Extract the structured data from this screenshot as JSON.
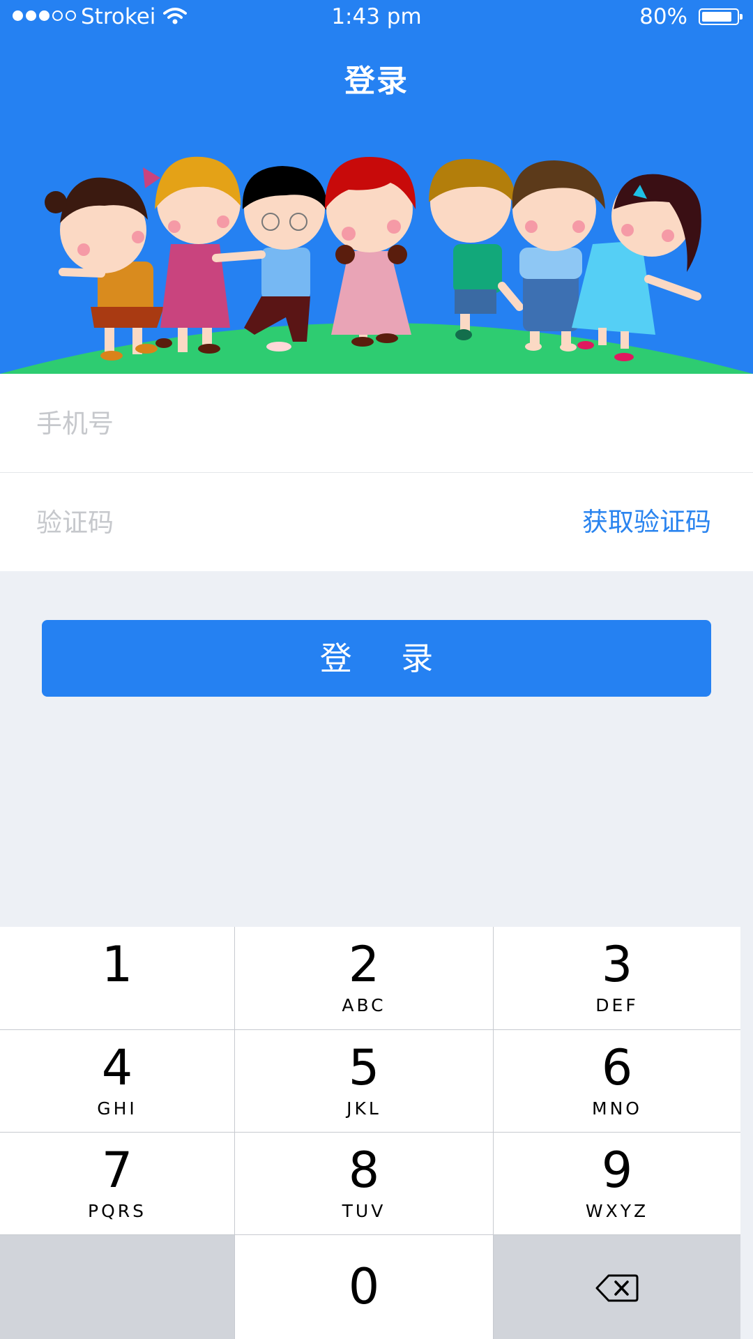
{
  "status_bar": {
    "carrier": "Strokei",
    "time": "1:43 pm",
    "battery": "80%",
    "battery_level": 0.8,
    "signal_bars": 3
  },
  "nav": {
    "title": "登录"
  },
  "form": {
    "phone_placeholder": "手机号",
    "phone_value": "",
    "code_placeholder": "验证码",
    "code_value": "",
    "get_code_label": "获取验证码"
  },
  "login_button": {
    "label": "登 录"
  },
  "keypad": {
    "keys": [
      {
        "num": "1",
        "letters": ""
      },
      {
        "num": "2",
        "letters": "ABC"
      },
      {
        "num": "3",
        "letters": "DEF"
      },
      {
        "num": "4",
        "letters": "GHI"
      },
      {
        "num": "5",
        "letters": "JKL"
      },
      {
        "num": "6",
        "letters": "MNO"
      },
      {
        "num": "7",
        "letters": "PQRS"
      },
      {
        "num": "8",
        "letters": "TUV"
      },
      {
        "num": "9",
        "letters": "WXYZ"
      },
      {
        "num": "0",
        "letters": ""
      }
    ]
  },
  "colors": {
    "brand": "#2581f2",
    "link": "#2a84ef",
    "hill": "#2ecc71",
    "background": "#edf0f5"
  }
}
